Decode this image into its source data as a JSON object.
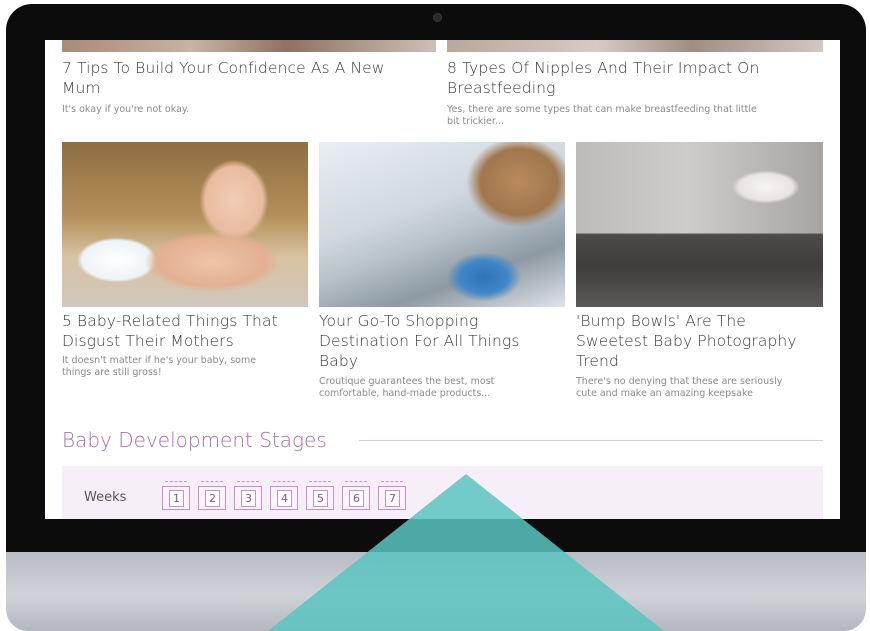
{
  "articles_top": [
    {
      "title_line1": "7 Tips To Build Your Confidence As A New",
      "title_line2": "Mum",
      "desc_line1": "It's okay if you're not okay.",
      "desc_line2": ""
    },
    {
      "title_line1": "8 Types Of Nipples And Their Impact On",
      "title_line2": "Breastfeeding",
      "desc_line1": "Yes, there are some types that can make breastfeeding that little",
      "desc_line2": "bit trickier..."
    }
  ],
  "articles_row": [
    {
      "title_line1": "5 Baby-Related Things That",
      "title_line2": "Disgust Their Mothers",
      "title_line3": "",
      "desc_line1": "It doesn't matter if he's your baby, some",
      "desc_line2": "things are still gross!"
    },
    {
      "title_line1": "Your Go-To Shopping",
      "title_line2": "Destination For All Things",
      "title_line3": "Baby",
      "desc_line1": "Croutique guarantees the best, most",
      "desc_line2": "comfortable, hand-made products..."
    },
    {
      "title_line1": "'Bump Bowls' Are The",
      "title_line2": "Sweetest Baby Photography",
      "title_line3": "Trend",
      "desc_line1": "There's no denying that these are seriously",
      "desc_line2": "cute and make an amazing keepsake"
    }
  ],
  "development": {
    "title": "Baby Development Stages",
    "weeks_label": "Weeks",
    "weeks": [
      "1",
      "2",
      "3",
      "4",
      "5",
      "6",
      "7"
    ]
  },
  "colors": {
    "accent_purple": "#a66bb4",
    "panel_pink": "#f7eff8",
    "teal": "#5bc4bf"
  }
}
